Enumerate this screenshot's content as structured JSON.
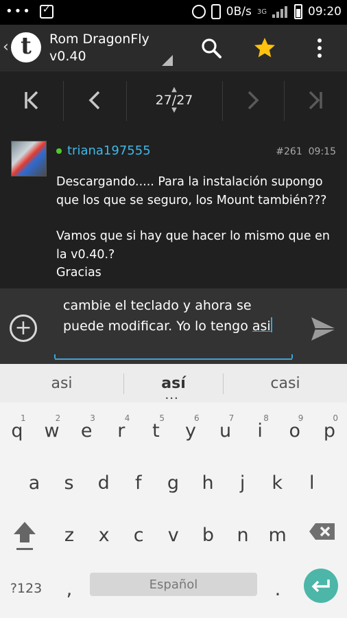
{
  "status_bar": {
    "left_icons": [
      "more-dots-icon",
      "briefcase-check-icon"
    ],
    "net_speed": "0B/s",
    "network_type": "3G",
    "time": "09:20",
    "right_icons": [
      "alarm-icon",
      "vibrate-icon",
      "signal-icon",
      "battery-icon"
    ]
  },
  "action_bar": {
    "title_line1": "Rom DragonFly",
    "title_line2": "v0.40",
    "app_logo_letter": "t",
    "icons": [
      "back-chevron-icon",
      "search-icon",
      "star-icon",
      "overflow-menu-icon"
    ],
    "star_color": "#ffc20e"
  },
  "pager": {
    "page_indicator": "27/27",
    "current_page": 27,
    "total_pages": 27,
    "buttons": [
      "first-page-icon",
      "prev-page-icon",
      "next-page-icon",
      "last-page-icon"
    ]
  },
  "post": {
    "author": "triana197555",
    "post_number": "#261",
    "time": "09:15",
    "online_color": "#4ecb2c",
    "author_color": "#3fb8e8",
    "body_line1": "Descargando..... Para la instalación supongo que los que se seguro, los Mount también???",
    "body_line2": "Vamos que si hay que hacer lo mismo que en la v0.40.?",
    "body_line3": "Gracias"
  },
  "compose": {
    "text_before": "cambie el teclado y ahora se puede modificar. Yo lo tengo ",
    "text_current_word": "asi",
    "accent_color": "#3ba5d6"
  },
  "keyboard": {
    "suggestions": [
      "asi",
      "así",
      "casi"
    ],
    "row1": [
      {
        "key": "q",
        "hint": "1"
      },
      {
        "key": "w",
        "hint": "2"
      },
      {
        "key": "e",
        "hint": "3"
      },
      {
        "key": "r",
        "hint": "4"
      },
      {
        "key": "t",
        "hint": "5"
      },
      {
        "key": "y",
        "hint": "6"
      },
      {
        "key": "u",
        "hint": "7"
      },
      {
        "key": "i",
        "hint": "8"
      },
      {
        "key": "o",
        "hint": "9"
      },
      {
        "key": "p",
        "hint": "0"
      }
    ],
    "row2": [
      "a",
      "s",
      "d",
      "f",
      "g",
      "h",
      "j",
      "k",
      "l"
    ],
    "row3": [
      "z",
      "x",
      "c",
      "v",
      "b",
      "n",
      "m"
    ],
    "symbols_key": "?123",
    "comma_key": ",",
    "space_label": "Español",
    "period_key": ".",
    "enter_color": "#4cb6a8"
  }
}
